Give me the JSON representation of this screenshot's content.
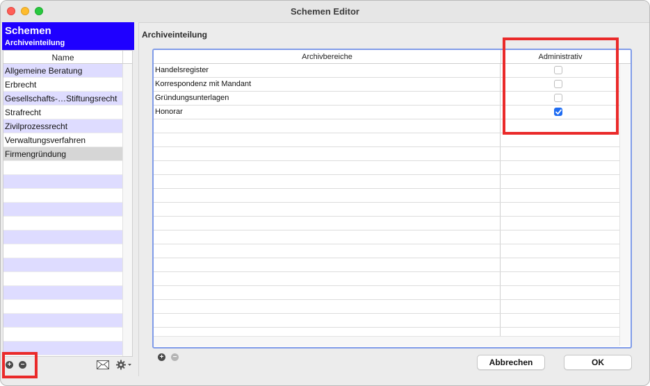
{
  "window": {
    "title": "Schemen Editor"
  },
  "left_panel": {
    "header_title": "Schemen",
    "header_subtitle": "Archiveinteilung",
    "column_header": "Name",
    "items": [
      {
        "label": "Allgemeine Beratung"
      },
      {
        "label": "Erbrecht"
      },
      {
        "label": "Gesellschafts-…Stiftungsrecht"
      },
      {
        "label": "Strafrecht"
      },
      {
        "label": "Zivilprozessrecht"
      },
      {
        "label": "Verwaltungsverfahren"
      },
      {
        "label": "Firmengründung",
        "selected": true
      }
    ]
  },
  "right_panel": {
    "section_title": "Archiveinteilung",
    "columns": [
      "Archivbereiche",
      "Administrativ"
    ],
    "rows": [
      {
        "name": "Handelsregister",
        "administrativ": false
      },
      {
        "name": "Korrespondenz mit Mandant",
        "administrativ": false
      },
      {
        "name": "Gründungsunterlagen",
        "administrativ": false
      },
      {
        "name": "Honorar",
        "administrativ": true
      }
    ]
  },
  "buttons": {
    "cancel": "Abbrechen",
    "ok": "OK"
  },
  "colors": {
    "header_bg": "#1f00ff",
    "list_alt_row": "#dedcff",
    "list_selected_row": "#d6d6d6",
    "checkbox_checked": "#1f6cf2",
    "table_frame": "#7f9be8",
    "highlight_box": "#ea2a2a"
  },
  "icons": {
    "left_footer": [
      "plus-circle-icon",
      "minus-circle-icon",
      "envelope-icon",
      "gear-dropdown-icon"
    ],
    "table_footer": [
      "plus-circle-icon",
      "minus-circle-icon"
    ]
  }
}
